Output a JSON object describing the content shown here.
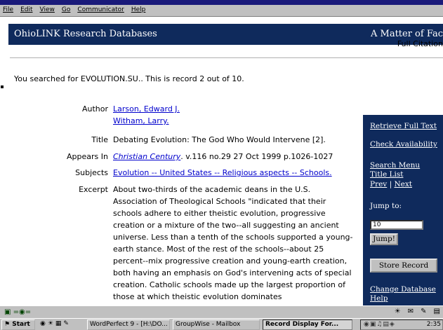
{
  "menu": [
    "File",
    "Edit",
    "View",
    "Go",
    "Communicator",
    "Help"
  ],
  "header": {
    "site_title": "OhioLINK Research Databases",
    "tagline": "A Matter of Fac",
    "subhead": "Full Citation"
  },
  "search_info": "You searched for EVOLUTION.SU.. This is record 2 out of 10.",
  "record": {
    "author_label": "Author",
    "authors": [
      "Larson, Edward J.",
      "Witham, Larry."
    ],
    "title_label": "Title",
    "title": "Debating Evolution: The God Who Would Intervene [2].",
    "appears_label": "Appears In",
    "appears_source": "Christian Century",
    "appears_rest": ". v.116 no.29 27 Oct 1999 p.1026-1027",
    "subjects_label": "Subjects",
    "subjects": "Evolution -- United States -- Religious aspects -- Schools.",
    "excerpt_label": "Excerpt",
    "excerpt": "About two-thirds of the academic deans in the U.S. Association of Theological Schools \"indicated that their schools adhere to either theistic evolution, progressive creation or a mixture of the two--all suggesting an ancient universe. Less than a tenth of the schools supported a young-earth stance. Most of the rest of the schools--about 25 percent--mix progressive creation and young-earth creation, both having an emphasis on God's intervening acts of special creation. Catholic schools made up the largest proportion of those at which theistic evolution dominates"
  },
  "nav": {
    "retrieve_full_text": "Retrieve Full Text",
    "check_availability": "Check Availability",
    "search_menu": "Search Menu",
    "title_list": "Title List",
    "prev": "Prev",
    "separator": "|",
    "next": "Next",
    "jump_to": "Jump to:",
    "jump_value": "10",
    "jump_button": "Jump!",
    "store_record": "Store Record",
    "change_database": "Change Database",
    "help": "Help"
  },
  "taskbar": {
    "start": "Start",
    "tasks": [
      "WordPerfect 9 - [H:\\DO...",
      "GroupWise - Mailbox",
      "Record Display For..."
    ],
    "clock": "2:35"
  },
  "colors": {
    "header_bg": "#0f2a5c",
    "link": "#0000cc",
    "chrome": "#c0c0c0"
  }
}
